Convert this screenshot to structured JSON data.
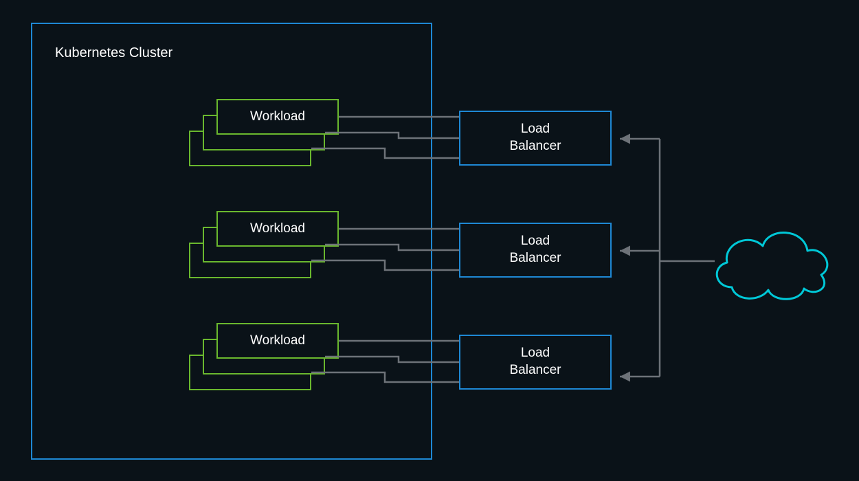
{
  "cluster": {
    "title": "Kubernetes Cluster"
  },
  "workloads": [
    {
      "label": "Workload"
    },
    {
      "label": "Workload"
    },
    {
      "label": "Workload"
    }
  ],
  "loadBalancers": [
    {
      "label": "Load\nBalancer"
    },
    {
      "label": "Load\nBalancer"
    },
    {
      "label": "Load\nBalancer"
    }
  ],
  "colors": {
    "background": "#0a1218",
    "clusterBorder": "#1e88d4",
    "workloadBorder": "#6ab82e",
    "connector": "#6d7278",
    "cloud": "#00c8d7"
  }
}
